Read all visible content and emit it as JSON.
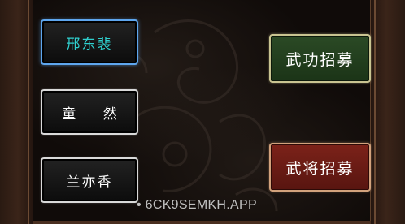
{
  "name_options": [
    {
      "label": "邢东裴",
      "selected": true
    },
    {
      "label": "童 然",
      "selected": false
    },
    {
      "label": "兰亦香",
      "selected": false
    }
  ],
  "recruit": {
    "martial_label": "武功招募",
    "general_label": "武将招募"
  },
  "watermark": "• 6CK9SEMKH.APP",
  "colors": {
    "selected_border": "#5ea6ee",
    "selected_text": "#2fd0cf",
    "martial_button": "#2b4a25",
    "general_button": "#7c2219"
  }
}
